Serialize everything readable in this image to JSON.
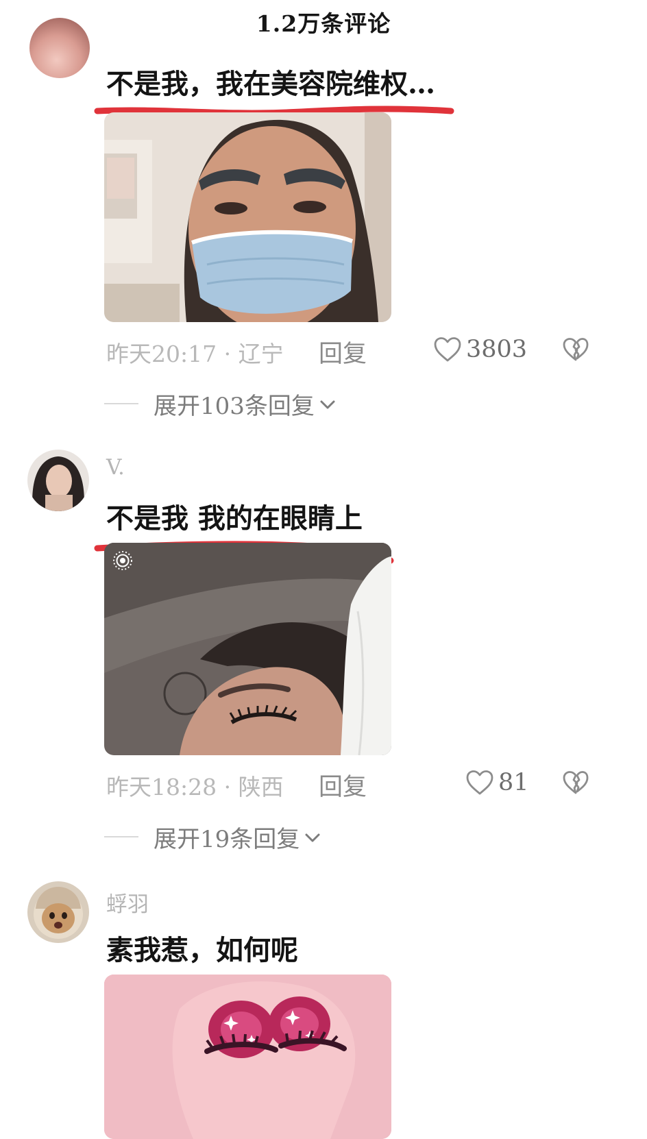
{
  "header": {
    "title": "1.2万条评论"
  },
  "comments": [
    {
      "text": "不是我，我在美容院维权…",
      "time_location": "昨天20:17 · 辽宁",
      "reply_label": "回复",
      "likes": "3803",
      "expand_label": "展开103条回复"
    },
    {
      "username": "V.",
      "text": "不是我 我的在眼睛上",
      "time_location": "昨天18:28 · 陕西",
      "reply_label": "回复",
      "likes": "81",
      "expand_label": "展开19条回复"
    },
    {
      "username": "蜉羽",
      "text": "素我惹，如何呢"
    }
  ],
  "colors": {
    "underline_red": "#e0333a",
    "text_primary": "#141414",
    "text_muted": "#b5b5b5"
  },
  "icons": [
    "heart-icon",
    "broken-heart-icon",
    "chevron-down-icon",
    "live-photo-icon"
  ]
}
